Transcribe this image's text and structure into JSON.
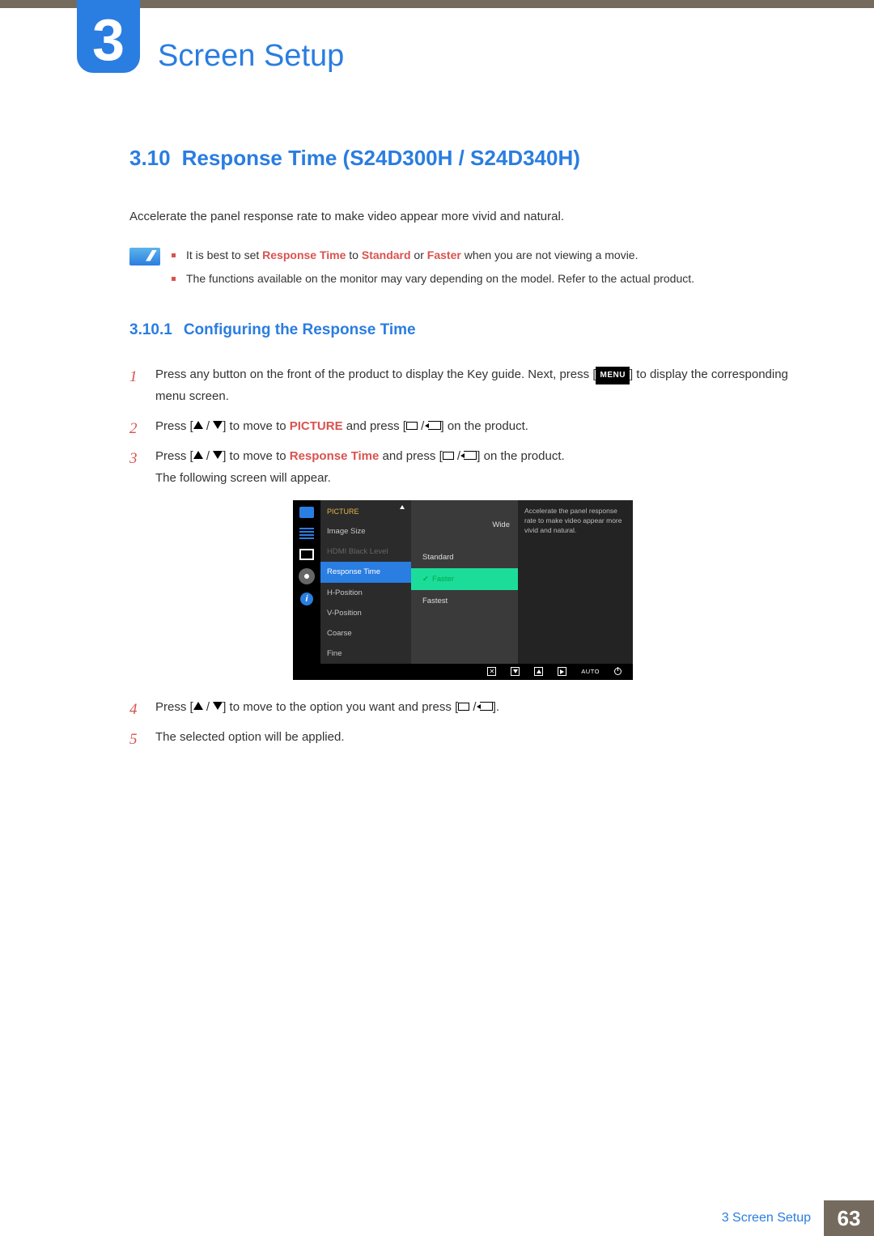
{
  "header": {
    "chapter_number": "3",
    "chapter_title": "Screen Setup"
  },
  "section": {
    "number": "3.10",
    "title": "Response Time (S24D300H / S24D340H)",
    "intro": "Accelerate the panel response rate to make video appear more vivid and natural."
  },
  "notes": {
    "item1_pre": "It is best to set ",
    "item1_kw1": "Response Time",
    "item1_mid1": " to ",
    "item1_kw2": "Standard",
    "item1_mid2": " or ",
    "item1_kw3": "Faster",
    "item1_post": " when you are not viewing a movie.",
    "item2": "The functions available on the monitor may vary depending on the model. Refer to the actual product."
  },
  "subsection": {
    "number": "3.10.1",
    "title": "Configuring the Response Time"
  },
  "steps": {
    "s1_a": "Press any button on the front of the product to display the Key guide. Next, press [",
    "s1_menu": "MENU",
    "s1_b": "] to display the corresponding menu screen.",
    "s2_a": "Press [",
    "s2_b": "] to move to ",
    "s2_kw": "PICTURE",
    "s2_c": " and press [",
    "s2_d": "] on the product.",
    "s3_a": "Press [",
    "s3_b": "] to move to ",
    "s3_kw": "Response Time",
    "s3_c": " and press [",
    "s3_d": "] on the product.",
    "s3_e": "The following screen will appear.",
    "s4_a": "Press [",
    "s4_b": "] to move to the option you want and press [",
    "s4_c": "].",
    "s5": "The selected option will be applied."
  },
  "osd": {
    "header": "PICTURE",
    "menu": {
      "image_size": "Image Size",
      "hdmi_black": "HDMI Black Level",
      "response_time": "Response Time",
      "h_position": "H-Position",
      "v_position": "V-Position",
      "coarse": "Coarse",
      "fine": "Fine"
    },
    "value_wide": "Wide",
    "options": {
      "standard": "Standard",
      "faster": "Faster",
      "fastest": "Fastest"
    },
    "help": "Accelerate the panel response rate to make video appear more vivid and natural.",
    "bottom": {
      "auto": "AUTO"
    }
  },
  "footer": {
    "label": "3 Screen Setup",
    "page": "63"
  }
}
